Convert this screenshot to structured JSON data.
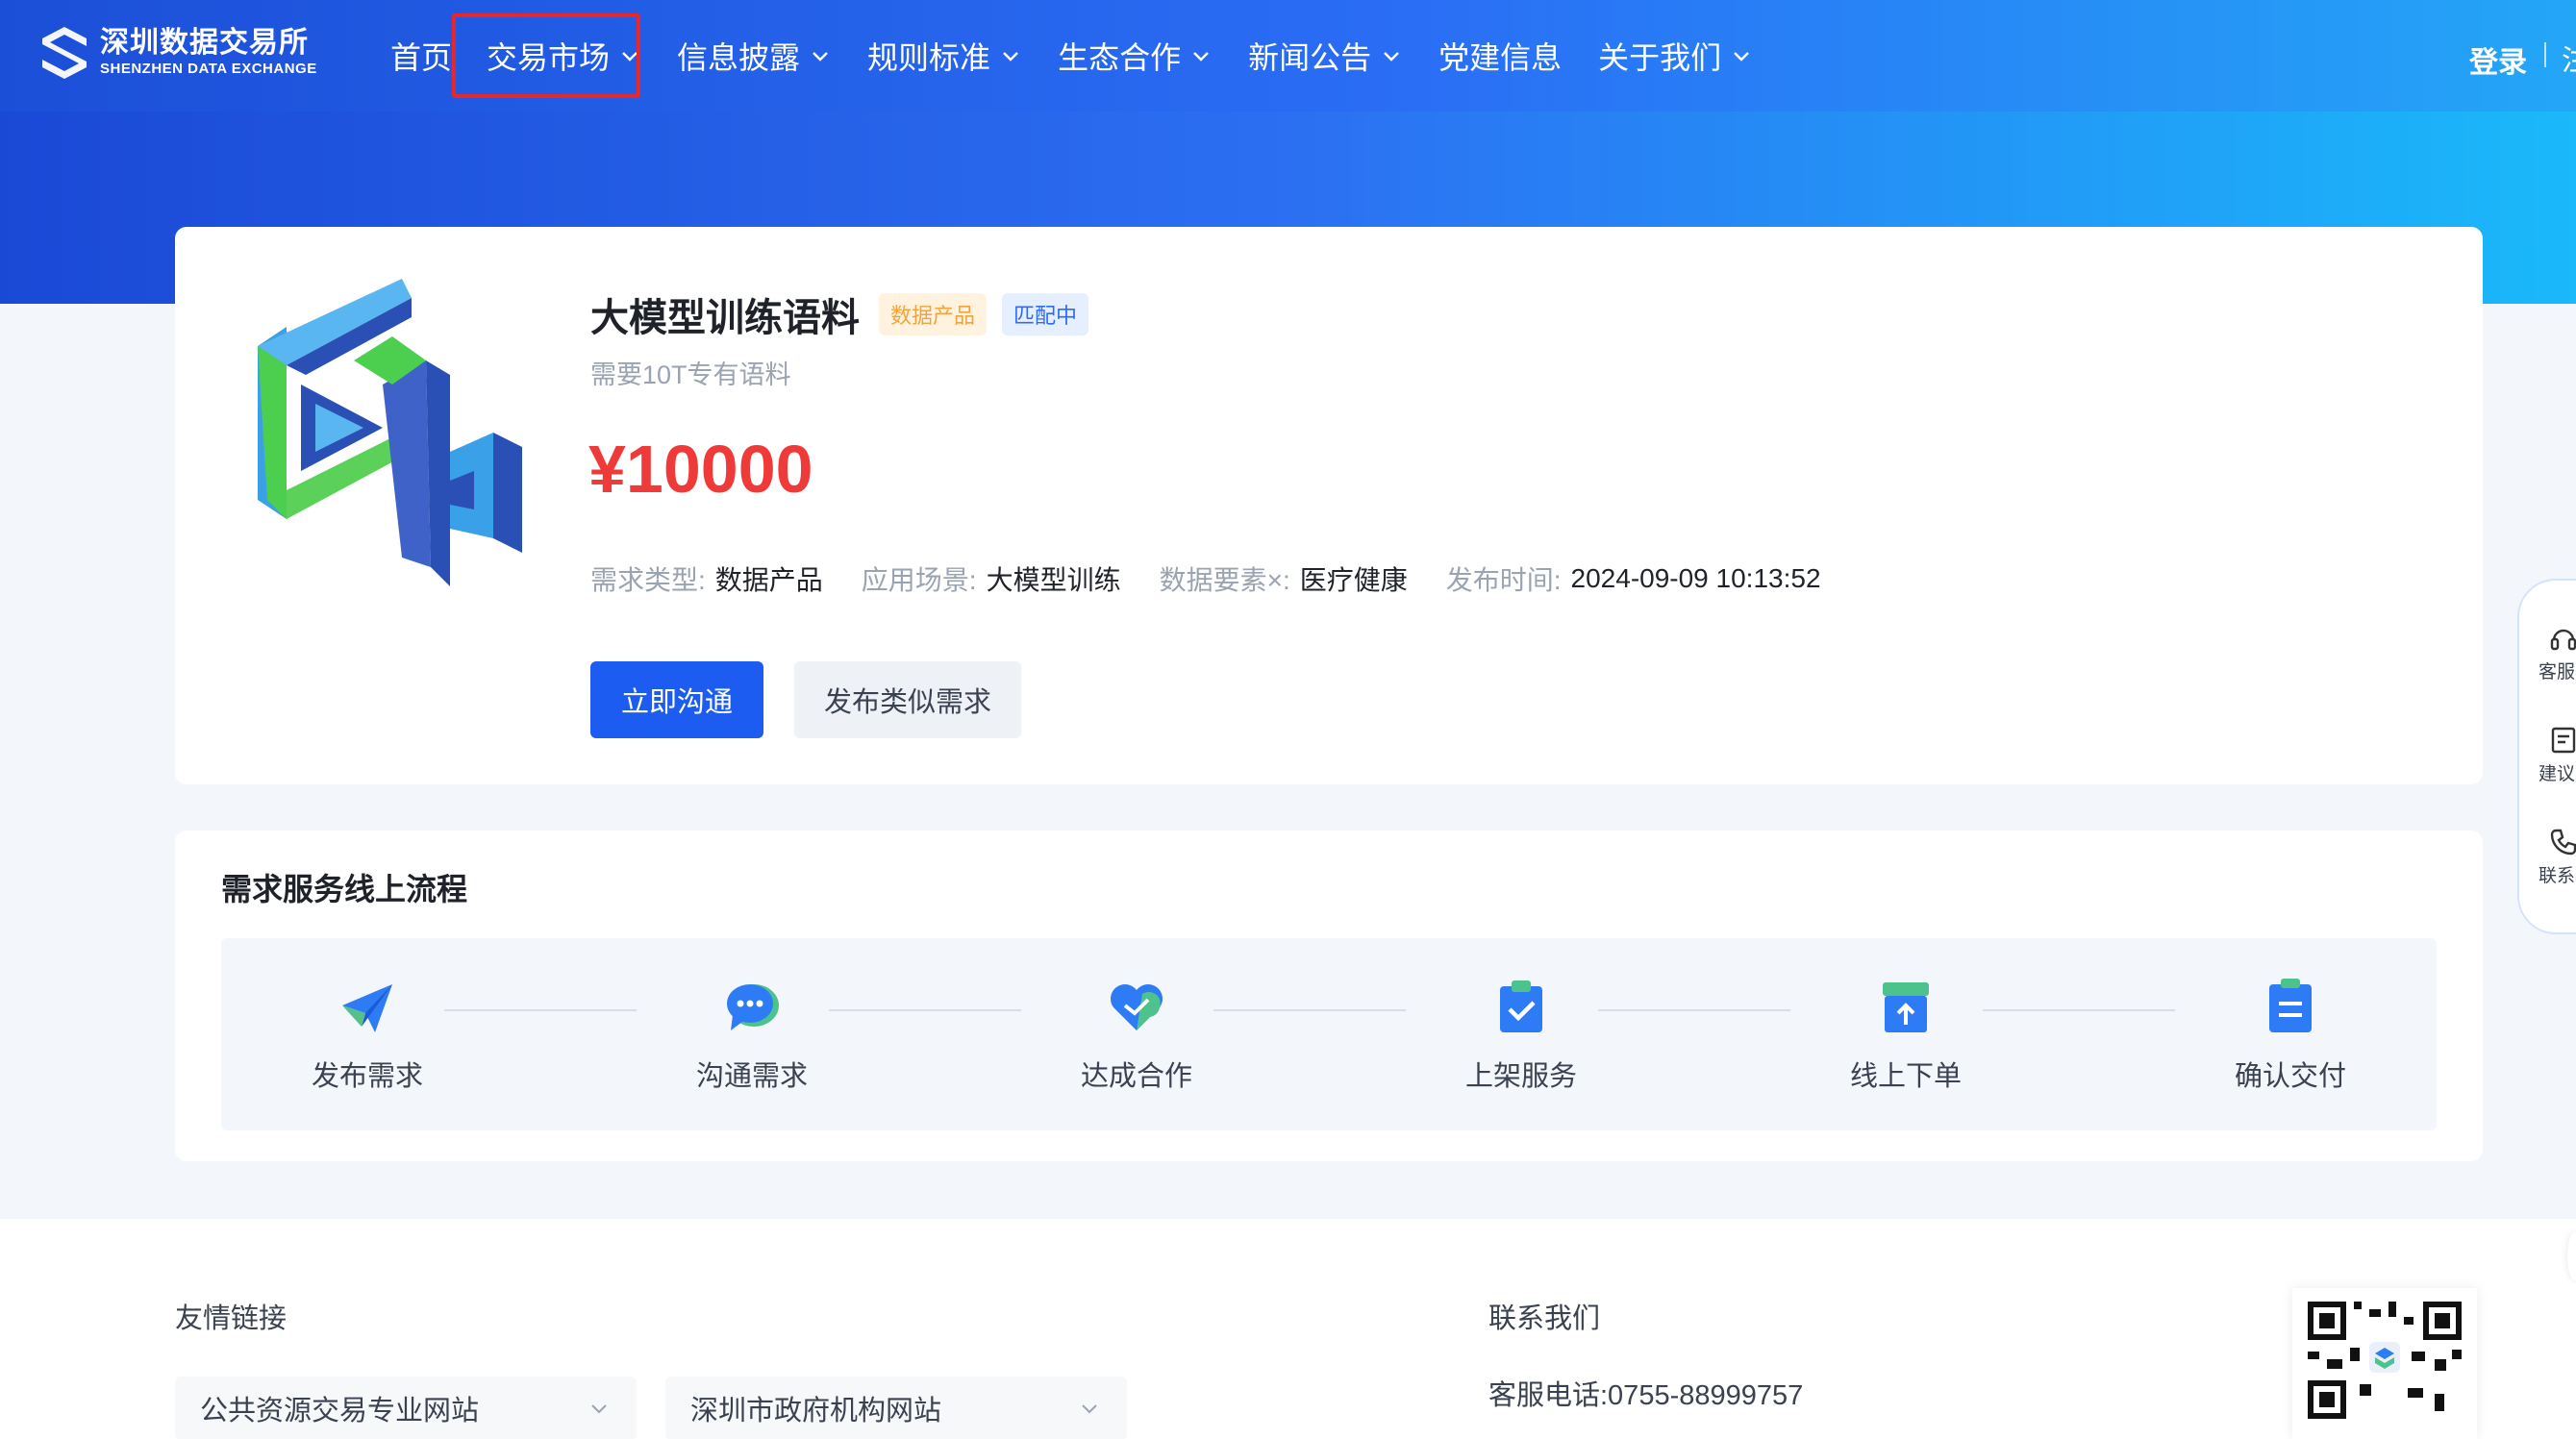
{
  "colors": {
    "brand_blue": "#1d5cf0",
    "price_red": "#ef3a3a",
    "highlight_red": "#e8262b",
    "tag_orange": "#f2a43a",
    "tag_blue": "#2f6bf0"
  },
  "header": {
    "logo_cn": "深圳数据交易所",
    "logo_en": "SHENZHEN DATA EXCHANGE",
    "nav": [
      {
        "label": "首页",
        "has_dropdown": false
      },
      {
        "label": "交易市场",
        "has_dropdown": true,
        "highlighted": true
      },
      {
        "label": "信息披露",
        "has_dropdown": true
      },
      {
        "label": "规则标准",
        "has_dropdown": true
      },
      {
        "label": "生态合作",
        "has_dropdown": true
      },
      {
        "label": "新闻公告",
        "has_dropdown": true
      },
      {
        "label": "党建信息",
        "has_dropdown": false
      },
      {
        "label": "关于我们",
        "has_dropdown": true
      }
    ],
    "login": "登录",
    "cut_text": "注"
  },
  "product": {
    "title": "大模型训练语料",
    "tag_type": "数据产品",
    "tag_status": "匹配中",
    "subtitle": "需要10T专有语料",
    "price": "¥10000",
    "meta": [
      {
        "key": "需求类型:",
        "value": "数据产品"
      },
      {
        "key": "应用场景:",
        "value": "大模型训练"
      },
      {
        "key": "数据要素×:",
        "value": "医疗健康"
      },
      {
        "key": "发布时间:",
        "value": "2024-09-09 10:13:52"
      }
    ],
    "primary_button": "立即沟通",
    "secondary_button": "发布类似需求"
  },
  "process": {
    "title": "需求服务线上流程",
    "steps": [
      {
        "label": "发布需求",
        "icon": "paper-plane-icon"
      },
      {
        "label": "沟通需求",
        "icon": "chat-bubble-icon"
      },
      {
        "label": "达成合作",
        "icon": "heart-handshake-icon"
      },
      {
        "label": "上架服务",
        "icon": "clipboard-check-icon"
      },
      {
        "label": "线上下单",
        "icon": "box-upload-icon"
      },
      {
        "label": "确认交付",
        "icon": "document-list-icon"
      }
    ]
  },
  "footer": {
    "links_title": "友情链接",
    "select_1": "公共资源交易专业网站",
    "select_2": "深圳市政府机构网站",
    "contact_title": "联系我们",
    "contact_phone": "客服电话:0755-88999757"
  },
  "float_bar": [
    {
      "label": "客服中心",
      "icon": "headset-icon"
    },
    {
      "label": "建议反馈",
      "icon": "feedback-icon"
    },
    {
      "label": "联系我们",
      "icon": "phone-icon"
    }
  ]
}
